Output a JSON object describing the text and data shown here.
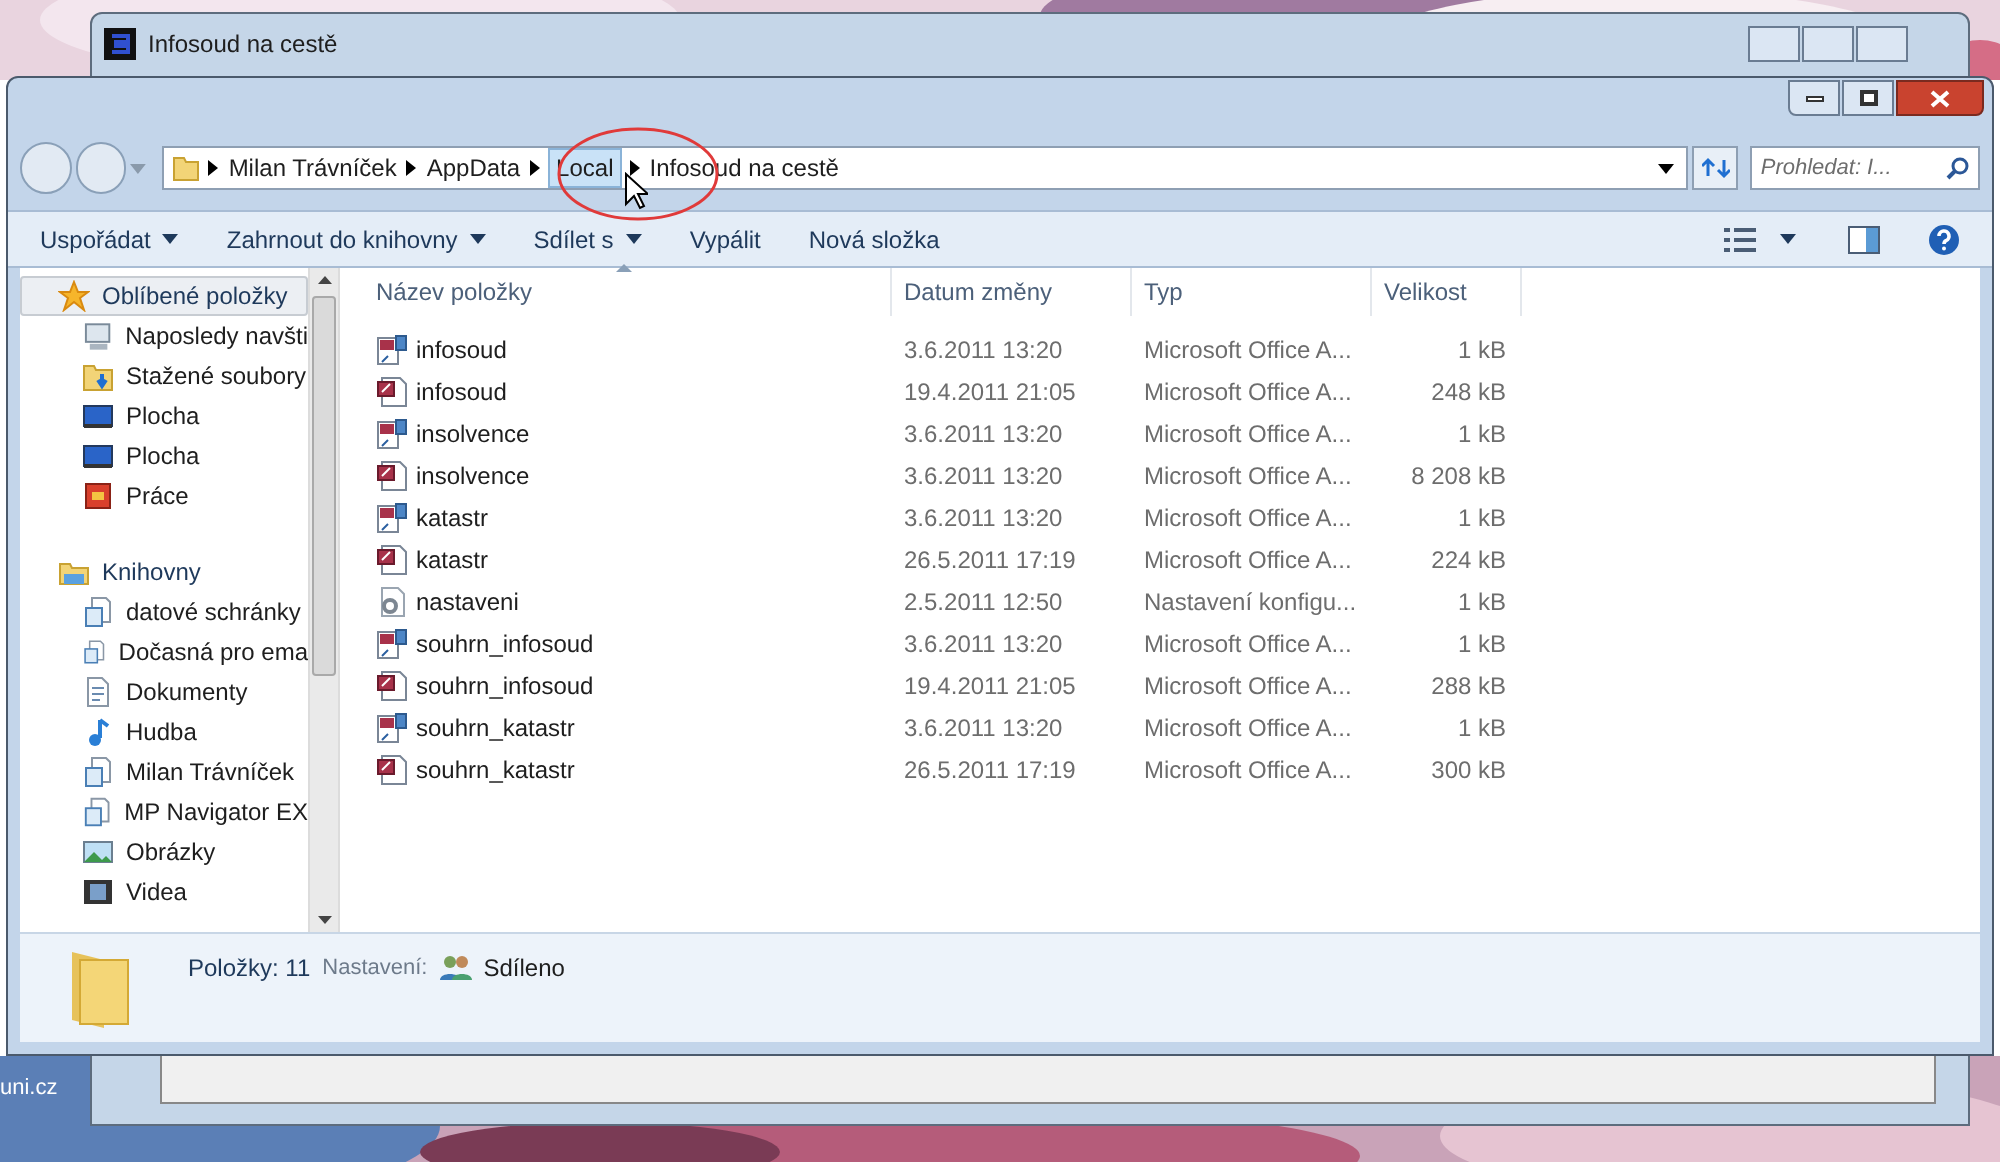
{
  "desktop_text": "uni.cz",
  "back_window": {
    "title": "Infosoud na cestě"
  },
  "window": {
    "breadcrumb": [
      {
        "label": "Milan Trávníček",
        "selected": false
      },
      {
        "label": "AppData",
        "selected": false
      },
      {
        "label": "Local",
        "selected": true
      },
      {
        "label": "Infosoud na cestě",
        "selected": false
      }
    ],
    "search": {
      "placeholder": "Prohledat: I..."
    },
    "toolbar": [
      {
        "label": "Uspořádat",
        "dropdown": true
      },
      {
        "label": "Zahrnout do knihovny",
        "dropdown": true
      },
      {
        "label": "Sdílet s",
        "dropdown": true
      },
      {
        "label": "Vypálit",
        "dropdown": false
      },
      {
        "label": "Nová složka",
        "dropdown": false
      }
    ],
    "sidebar": [
      {
        "label": "Oblíbené položky",
        "kind": "favorites",
        "selected": true,
        "children": [
          {
            "label": "Naposledy navšti",
            "kind": "recent"
          },
          {
            "label": "Stažené soubory",
            "kind": "downloads"
          },
          {
            "label": "Plocha",
            "kind": "desktop"
          },
          {
            "label": "Plocha",
            "kind": "desktop"
          },
          {
            "label": "Práce",
            "kind": "work"
          }
        ]
      },
      {
        "label": "Knihovny",
        "kind": "libraries",
        "selected": false,
        "children": [
          {
            "label": "datové schránky",
            "kind": "library"
          },
          {
            "label": "Dočasná pro ema",
            "kind": "library"
          },
          {
            "label": "Dokumenty",
            "kind": "documents"
          },
          {
            "label": "Hudba",
            "kind": "music"
          },
          {
            "label": "Milan Trávníček",
            "kind": "library"
          },
          {
            "label": "MP Navigator EX",
            "kind": "library"
          },
          {
            "label": "Obrázky",
            "kind": "pictures"
          },
          {
            "label": "Videa",
            "kind": "videos"
          }
        ]
      }
    ],
    "columns": [
      "Název položky",
      "Datum změny",
      "Typ",
      "Velikost"
    ],
    "rows": [
      {
        "name": "infosoud",
        "date": "3.6.2011 13:20",
        "type": "Microsoft Office A...",
        "size": "1 kB",
        "kind": "shortcut"
      },
      {
        "name": "infosoud",
        "date": "19.4.2011 21:05",
        "type": "Microsoft Office A...",
        "size": "248 kB",
        "kind": "database"
      },
      {
        "name": "insolvence",
        "date": "3.6.2011 13:20",
        "type": "Microsoft Office A...",
        "size": "1 kB",
        "kind": "shortcut"
      },
      {
        "name": "insolvence",
        "date": "3.6.2011 13:20",
        "type": "Microsoft Office A...",
        "size": "8 208 kB",
        "kind": "database"
      },
      {
        "name": "katastr",
        "date": "3.6.2011 13:20",
        "type": "Microsoft Office A...",
        "size": "1 kB",
        "kind": "shortcut"
      },
      {
        "name": "katastr",
        "date": "26.5.2011 17:19",
        "type": "Microsoft Office A...",
        "size": "224 kB",
        "kind": "database"
      },
      {
        "name": "nastaveni",
        "date": "2.5.2011 12:50",
        "type": "Nastavení konfigu...",
        "size": "1 kB",
        "kind": "config"
      },
      {
        "name": "souhrn_infosoud",
        "date": "3.6.2011 13:20",
        "type": "Microsoft Office A...",
        "size": "1 kB",
        "kind": "shortcut"
      },
      {
        "name": "souhrn_infosoud",
        "date": "19.4.2011 21:05",
        "type": "Microsoft Office A...",
        "size": "288 kB",
        "kind": "database"
      },
      {
        "name": "souhrn_katastr",
        "date": "3.6.2011 13:20",
        "type": "Microsoft Office A...",
        "size": "1 kB",
        "kind": "shortcut"
      },
      {
        "name": "souhrn_katastr",
        "date": "26.5.2011 17:19",
        "type": "Microsoft Office A...",
        "size": "300 kB",
        "kind": "database"
      }
    ],
    "status": {
      "count": "Položky: 11",
      "setting_label": "Nastavení:",
      "setting_value": "Sdíleno"
    }
  }
}
